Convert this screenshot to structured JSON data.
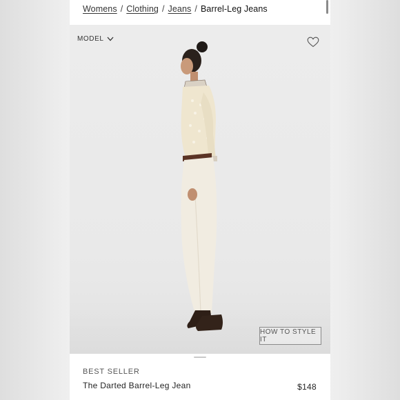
{
  "breadcrumb": {
    "items": [
      {
        "label": "Womens"
      },
      {
        "label": "Clothing"
      },
      {
        "label": "Jeans"
      }
    ],
    "separator": "/",
    "current": "Barrel-Leg Jeans"
  },
  "gallery": {
    "model_toggle_label": "MODEL",
    "model_toggle_icon": "chevron-down-icon",
    "favorite_icon": "heart-icon",
    "style_button_label": "HOW TO STYLE IT"
  },
  "product": {
    "badge": "BEST SELLER",
    "name": "The Darted Barrel-Leg Jean",
    "price": "$148"
  },
  "colors": {
    "background": "#ffffff",
    "text": "#222222",
    "image_bg": "#ebebeb",
    "sweater": "#efe6cf",
    "jeans": "#f1ece1",
    "boots": "#2e1f17"
  }
}
